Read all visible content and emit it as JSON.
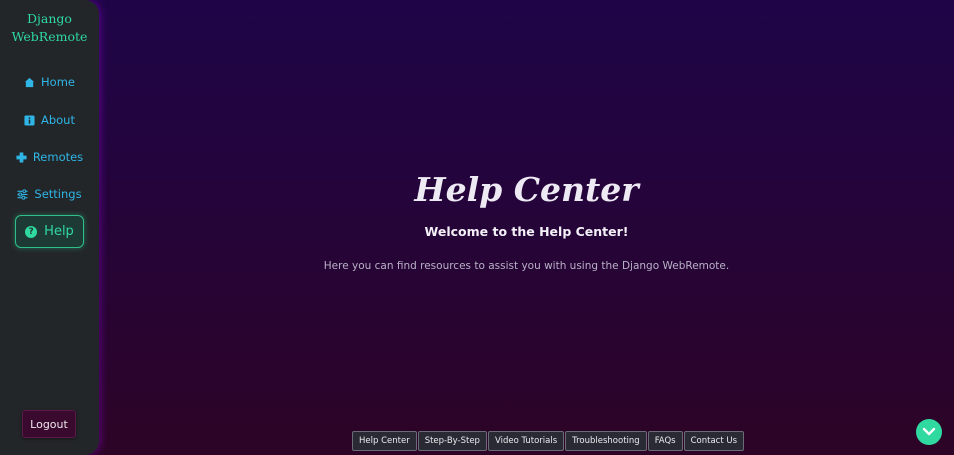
{
  "brand": {
    "line1": "Django",
    "line2": "WebRemote"
  },
  "sidebar": {
    "items": [
      {
        "label": "Home",
        "icon": "home-icon"
      },
      {
        "label": "About",
        "icon": "info-icon"
      },
      {
        "label": "Remotes",
        "icon": "gamepad-icon"
      },
      {
        "label": "Settings",
        "icon": "sliders-icon"
      },
      {
        "label": "Help",
        "icon": "question-circle-icon",
        "active": true
      }
    ],
    "logout_label": "Logout"
  },
  "main": {
    "title": "Help Center",
    "subtitle": "Welcome to the Help Center!",
    "description": "Here you can find resources to assist you with using the Django WebRemote."
  },
  "footer_nav": {
    "tabs": [
      "Help Center",
      "Step-By-Step",
      "Video Tutorials",
      "Troubleshooting",
      "FAQs",
      "Contact Us"
    ]
  },
  "colors": {
    "accent_green": "#2fd9a0",
    "nav_blue": "#2fb5e6",
    "sidebar_bg": "#232629",
    "background_top": "#1f0548",
    "background_bottom": "#2d0426"
  },
  "scroll_button": {
    "icon": "chevron-down-icon"
  }
}
